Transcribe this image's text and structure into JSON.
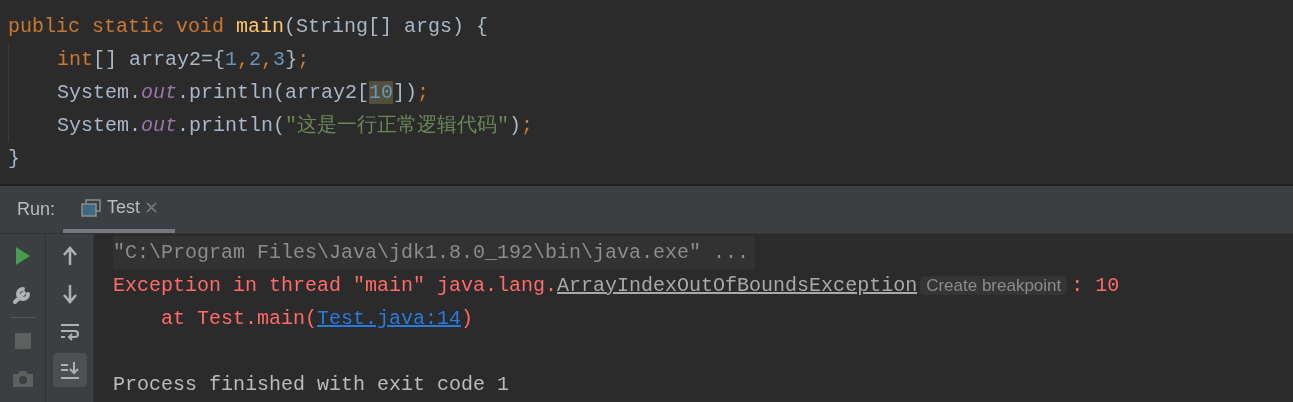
{
  "code": {
    "signature": [
      {
        "text": "public static void ",
        "kind": "keyword"
      },
      {
        "text": "main",
        "kind": "function"
      },
      {
        "text": "(String[] args) {",
        "kind": "plain"
      }
    ],
    "body": [
      [
        {
          "text": "int",
          "kind": "keyword"
        },
        {
          "text": "[] array2={",
          "kind": "plain"
        },
        {
          "text": "1",
          "kind": "number"
        },
        {
          "text": ",",
          "kind": "punct"
        },
        {
          "text": "2",
          "kind": "number"
        },
        {
          "text": ",",
          "kind": "punct"
        },
        {
          "text": "3",
          "kind": "number"
        },
        {
          "text": "}",
          "kind": "plain"
        },
        {
          "text": ";",
          "kind": "punct"
        }
      ],
      [
        {
          "text": "System.",
          "kind": "plain"
        },
        {
          "text": "out",
          "kind": "field"
        },
        {
          "text": ".println(array2[",
          "kind": "plain"
        },
        {
          "text": "10",
          "kind": "match"
        },
        {
          "text": "])",
          "kind": "plain"
        },
        {
          "text": ";",
          "kind": "punct"
        }
      ],
      [
        {
          "text": "System.",
          "kind": "plain"
        },
        {
          "text": "out",
          "kind": "field"
        },
        {
          "text": ".println(",
          "kind": "plain"
        },
        {
          "text": "\"这是一行正常逻辑代码\"",
          "kind": "string"
        },
        {
          "text": ")",
          "kind": "plain"
        },
        {
          "text": ";",
          "kind": "punct"
        }
      ]
    ],
    "closing": "}"
  },
  "run_panel": {
    "label": "Run:",
    "tabs": [
      {
        "label": "Test",
        "selected": true
      }
    ],
    "left_tools": [
      {
        "kind": "run",
        "disabled": false
      },
      {
        "kind": "wrench",
        "disabled": false
      },
      {
        "kind": "stop",
        "disabled": true
      },
      {
        "kind": "camera",
        "disabled": true
      }
    ],
    "right_tools": [
      {
        "kind": "up",
        "selected": false
      },
      {
        "kind": "down",
        "selected": false
      },
      {
        "kind": "wrap",
        "selected": false
      },
      {
        "kind": "scroll-end",
        "selected": true
      }
    ],
    "console_blocks": [
      [
        {
          "kind": "command",
          "segments": [
            {
              "text": "\"C:\\Program Files\\Java\\jdk1.8.0_192\\bin\\java.exe\" ...",
              "kind": "text"
            }
          ]
        },
        {
          "kind": "error",
          "segments": [
            {
              "text": "Exception in thread \"main\" java.lang.",
              "kind": "text"
            },
            {
              "text": "ArrayIndexOutOfBoundsException",
              "kind": "class-link"
            },
            {
              "text": "Create breakpoint",
              "kind": "hint"
            },
            {
              "text": ": 10",
              "kind": "text"
            }
          ],
          "children": [
            {
              "kind": "error",
              "segments": [
                {
                  "text": "at Test.main(",
                  "kind": "text"
                },
                {
                  "text": "Test.java:14",
                  "kind": "link"
                },
                {
                  "text": ")",
                  "kind": "text"
                }
              ]
            }
          ]
        }
      ],
      [
        {
          "kind": "normal",
          "segments": [
            {
              "text": "Process finished with exit code 1",
              "kind": "text"
            }
          ]
        }
      ]
    ]
  }
}
